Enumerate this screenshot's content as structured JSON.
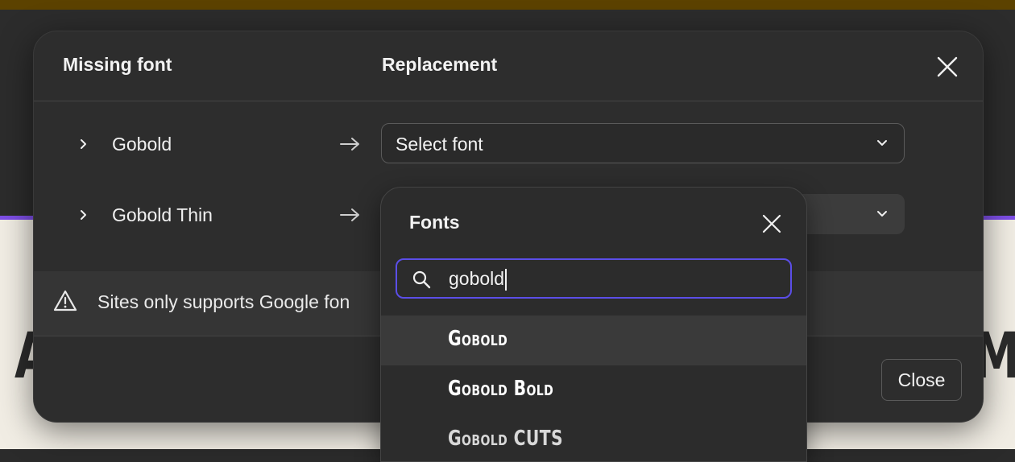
{
  "background": {
    "left_glyph": "A",
    "right_glyph": "M"
  },
  "modal": {
    "header": {
      "missing_label": "Missing font",
      "replacement_label": "Replacement"
    },
    "rows": [
      {
        "font_name": "Gobold",
        "select_value": "Select font"
      },
      {
        "font_name": "Gobold Thin",
        "select_value": ""
      }
    ],
    "warning_text": "Sites only supports Google fon",
    "close_button_label": "Close"
  },
  "dropdown": {
    "title": "Fonts",
    "search_value": "gobold",
    "options": [
      "Gobold",
      "Gobold Bold",
      "Gobold CUTS"
    ],
    "highlighted_index": 0
  },
  "colors": {
    "accent": "#5b4ee8",
    "top_bar": "#5c4200",
    "purple_line": "#7d4ee6",
    "modal_bg": "#2d2d2d"
  },
  "icons": [
    "chevron-right-icon",
    "arrow-right-icon",
    "chevron-down-icon",
    "close-icon",
    "warning-icon",
    "search-icon"
  ]
}
